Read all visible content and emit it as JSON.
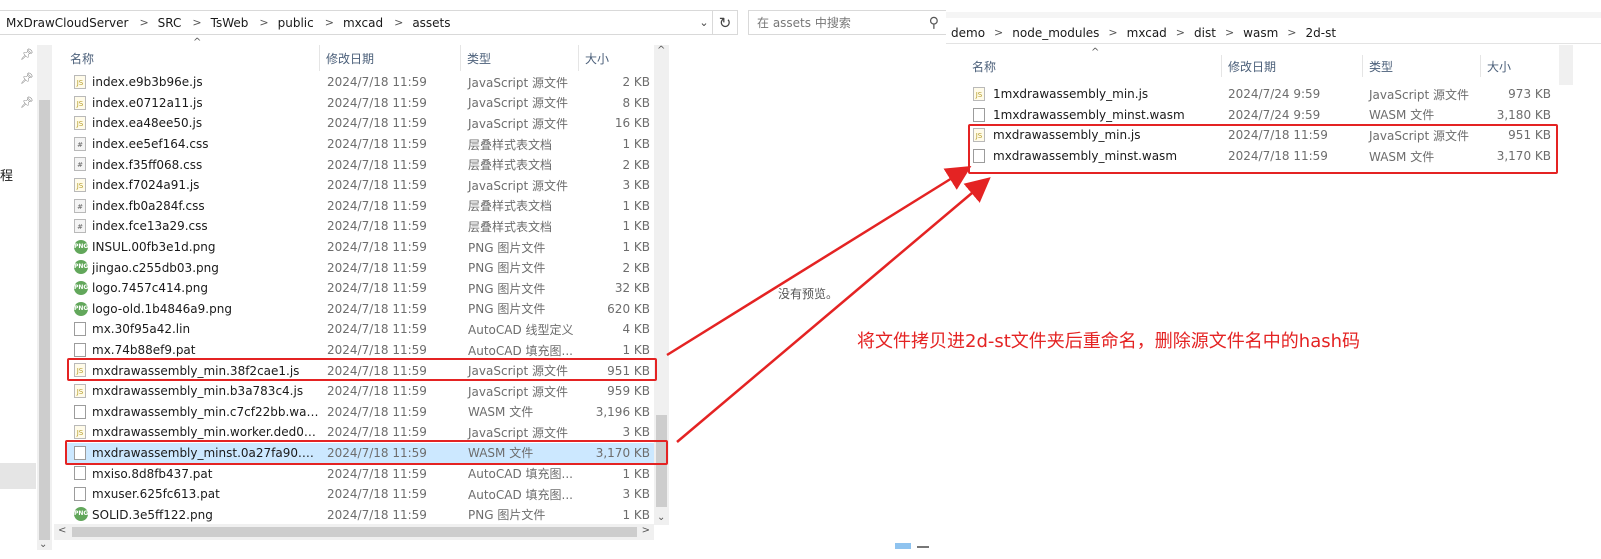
{
  "left": {
    "breadcrumb": [
      "MxDrawCloudServer",
      "SRC",
      "TsWeb",
      "public",
      "mxcad",
      "assets"
    ],
    "search_placeholder": "在 assets 中搜索",
    "nav_label": "程",
    "columns": {
      "name": "名称",
      "date": "修改日期",
      "type": "类型",
      "size": "大小"
    },
    "files": [
      {
        "name": "index.e9b3b96e.js",
        "date": "2024/7/18 11:59",
        "type": "JavaScript 源文件",
        "size": "2 KB",
        "icon": "js"
      },
      {
        "name": "index.e0712a11.js",
        "date": "2024/7/18 11:59",
        "type": "JavaScript 源文件",
        "size": "8 KB",
        "icon": "js"
      },
      {
        "name": "index.ea48ee50.js",
        "date": "2024/7/18 11:59",
        "type": "JavaScript 源文件",
        "size": "16 KB",
        "icon": "js"
      },
      {
        "name": "index.ee5ef164.css",
        "date": "2024/7/18 11:59",
        "type": "层叠样式表文档",
        "size": "1 KB",
        "icon": "css"
      },
      {
        "name": "index.f35ff068.css",
        "date": "2024/7/18 11:59",
        "type": "层叠样式表文档",
        "size": "2 KB",
        "icon": "css"
      },
      {
        "name": "index.f7024a91.js",
        "date": "2024/7/18 11:59",
        "type": "JavaScript 源文件",
        "size": "3 KB",
        "icon": "js"
      },
      {
        "name": "index.fb0a284f.css",
        "date": "2024/7/18 11:59",
        "type": "层叠样式表文档",
        "size": "1 KB",
        "icon": "css"
      },
      {
        "name": "index.fce13a29.css",
        "date": "2024/7/18 11:59",
        "type": "层叠样式表文档",
        "size": "1 KB",
        "icon": "css"
      },
      {
        "name": "INSUL.00fb3e1d.png",
        "date": "2024/7/18 11:59",
        "type": "PNG 图片文件",
        "size": "1 KB",
        "icon": "png"
      },
      {
        "name": "jingao.c255db03.png",
        "date": "2024/7/18 11:59",
        "type": "PNG 图片文件",
        "size": "2 KB",
        "icon": "png"
      },
      {
        "name": "logo.7457c414.png",
        "date": "2024/7/18 11:59",
        "type": "PNG 图片文件",
        "size": "32 KB",
        "icon": "png"
      },
      {
        "name": "logo-old.1b4846a9.png",
        "date": "2024/7/18 11:59",
        "type": "PNG 图片文件",
        "size": "620 KB",
        "icon": "png"
      },
      {
        "name": "mx.30f95a42.lin",
        "date": "2024/7/18 11:59",
        "type": "AutoCAD 线型定义",
        "size": "4 KB",
        "icon": "file"
      },
      {
        "name": "mx.74b88ef9.pat",
        "date": "2024/7/18 11:59",
        "type": "AutoCAD 填充图...",
        "size": "1 KB",
        "icon": "file"
      },
      {
        "name": "mxdrawassembly_min.38f2cae1.js",
        "date": "2024/7/18 11:59",
        "type": "JavaScript 源文件",
        "size": "951 KB",
        "icon": "js"
      },
      {
        "name": "mxdrawassembly_min.b3a783c4.js",
        "date": "2024/7/18 11:59",
        "type": "JavaScript 源文件",
        "size": "959 KB",
        "icon": "js"
      },
      {
        "name": "mxdrawassembly_min.c7cf22bb.wasm",
        "date": "2024/7/18 11:59",
        "type": "WASM 文件",
        "size": "3,196 KB",
        "icon": "file"
      },
      {
        "name": "mxdrawassembly_min.worker.ded005...",
        "date": "2024/7/18 11:59",
        "type": "JavaScript 源文件",
        "size": "3 KB",
        "icon": "js"
      },
      {
        "name": "mxdrawassembly_minst.0a27fa90.was...",
        "date": "2024/7/18 11:59",
        "type": "WASM 文件",
        "size": "3,170 KB",
        "icon": "file",
        "selected": true
      },
      {
        "name": "mxiso.8d8fb437.pat",
        "date": "2024/7/18 11:59",
        "type": "AutoCAD 填充图...",
        "size": "1 KB",
        "icon": "file"
      },
      {
        "name": "mxuser.625fc613.pat",
        "date": "2024/7/18 11:59",
        "type": "AutoCAD 填充图...",
        "size": "3 KB",
        "icon": "file"
      },
      {
        "name": "SOLID.3e5ff122.png",
        "date": "2024/7/18 11:59",
        "type": "PNG 图片文件",
        "size": "1 KB",
        "icon": "png"
      }
    ],
    "preview_text": "没有预览。"
  },
  "right": {
    "breadcrumb": [
      "demo",
      "node_modules",
      "mxcad",
      "dist",
      "wasm",
      "2d-st"
    ],
    "columns": {
      "name": "名称",
      "date": "修改日期",
      "type": "类型",
      "size": "大小"
    },
    "files": [
      {
        "name": "1mxdrawassembly_min.js",
        "date": "2024/7/24 9:59",
        "type": "JavaScript 源文件",
        "size": "973 KB",
        "icon": "js"
      },
      {
        "name": "1mxdrawassembly_minst.wasm",
        "date": "2024/7/24 9:59",
        "type": "WASM 文件",
        "size": "3,180 KB",
        "icon": "file"
      },
      {
        "name": "mxdrawassembly_min.js",
        "date": "2024/7/18 11:59",
        "type": "JavaScript 源文件",
        "size": "951 KB",
        "icon": "js"
      },
      {
        "name": "mxdrawassembly_minst.wasm",
        "date": "2024/7/18 11:59",
        "type": "WASM 文件",
        "size": "3,170 KB",
        "icon": "file"
      }
    ]
  },
  "annotation": "将文件拷贝进2d-st文件夹后重命名，删除源文件名中的hash码",
  "colors": {
    "highlight": "#e42323",
    "selection": "#cce8ff",
    "header_text": "#4c607a"
  }
}
